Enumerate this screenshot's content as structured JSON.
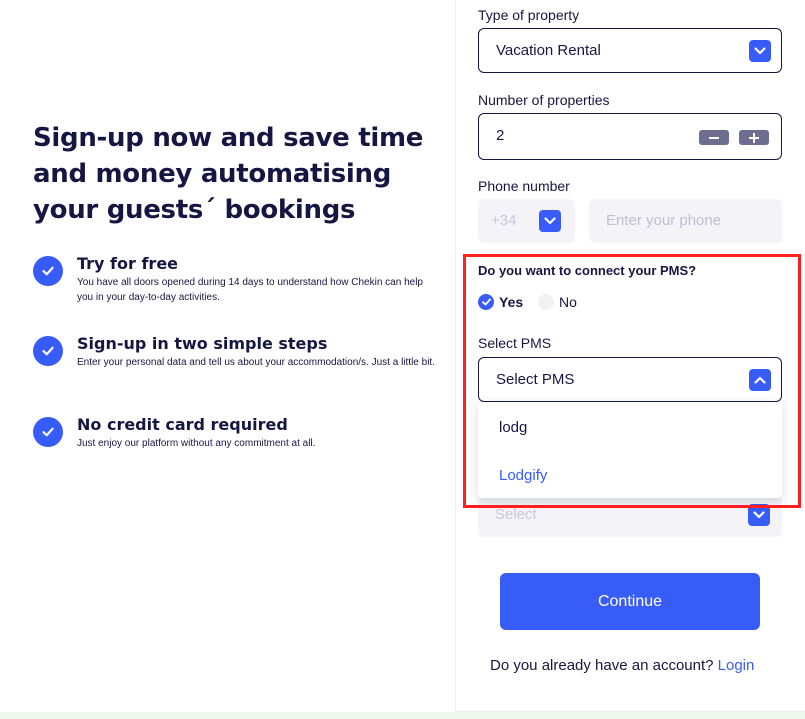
{
  "headline": [
    "Sign-up now and save time",
    "and money automatising",
    "your guests´ bookings"
  ],
  "features": [
    {
      "title": "Try for free",
      "desc": "You have all doors opened during 14 days to understand how Chekin can help you in your day-to-day activities."
    },
    {
      "title": "Sign-up in two simple steps",
      "desc": "Enter your personal data and tell us about your accommodation/s. Just a little bit."
    },
    {
      "title": "No credit card required",
      "desc": "Just enjoy our platform without any commitment at all."
    }
  ],
  "form": {
    "property_type": {
      "label": "Type of property",
      "value": "Vacation Rental"
    },
    "num_properties": {
      "label": "Number of properties",
      "value": "2",
      "minus": "−",
      "plus": "+"
    },
    "phone": {
      "label": "Phone number",
      "prefix": "+34",
      "placeholder": "Enter your phone"
    },
    "pms_question": "Do you want to connect your PMS?",
    "radio": {
      "yes": "Yes",
      "no": "No"
    },
    "select_pms": {
      "label": "Select PMS",
      "value": "Select PMS",
      "options": [
        "lodg",
        "Lodgify"
      ]
    },
    "next_select": {
      "placeholder": "Select"
    },
    "continue": "Continue",
    "account_prompt": "Do you already have an account?",
    "login": "Login"
  },
  "colors": {
    "accent": "#385cf8",
    "text": "#161643",
    "highlight": "#ff1f1f"
  }
}
